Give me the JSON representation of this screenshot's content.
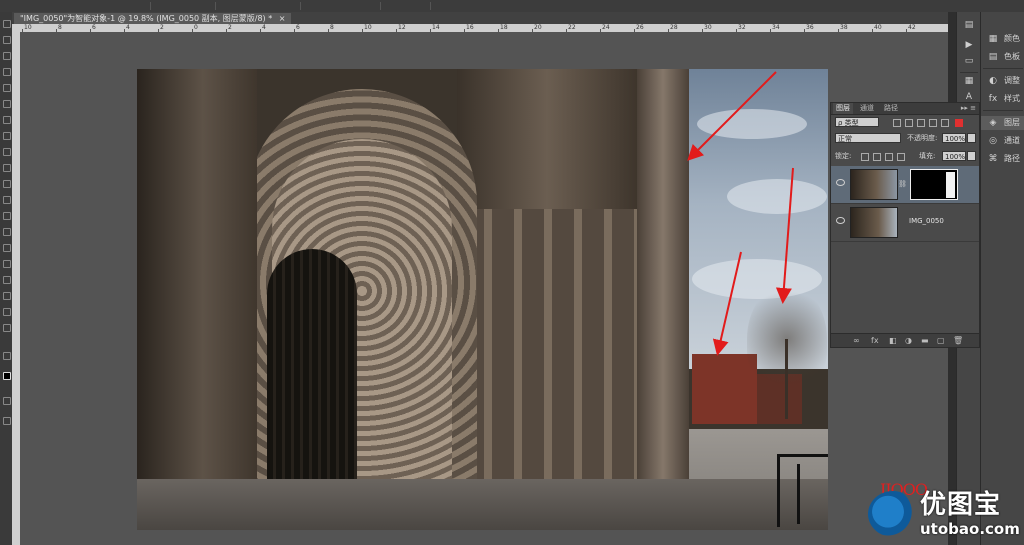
{
  "document": {
    "tab_title": "\"IMG_0050\"为智能对象-1 @ 19.8% (IMG_0050 副本, 图层蒙版/8) *",
    "close_icon": "×"
  },
  "ruler": {
    "labels": [
      "10",
      "8",
      "6",
      "4",
      "2",
      "0",
      "2",
      "4",
      "6",
      "8",
      "10",
      "12",
      "14",
      "16",
      "18",
      "20",
      "22",
      "24",
      "26",
      "28",
      "30",
      "32",
      "34",
      "36",
      "38",
      "40",
      "42"
    ]
  },
  "right_panels": {
    "items": [
      {
        "icon": "palette-icon",
        "glyph": "▦",
        "label": "颜色"
      },
      {
        "icon": "swatches-icon",
        "glyph": "▤",
        "label": "色板"
      },
      {
        "icon": "adjustments-icon",
        "glyph": "◐",
        "label": "调整"
      },
      {
        "icon": "styles-icon",
        "glyph": "fx",
        "label": "样式"
      },
      {
        "icon": "layers-icon",
        "glyph": "◈",
        "label": "图层"
      },
      {
        "icon": "channels-icon",
        "glyph": "◎",
        "label": "通道"
      },
      {
        "icon": "paths-icon",
        "glyph": "⌘",
        "label": "路径"
      }
    ]
  },
  "layers_panel": {
    "tabs": [
      "图层",
      "通道",
      "路径"
    ],
    "menu_glyph": "▸▸ ≡",
    "filter_label": "ρ 类型",
    "filter_icons": [
      "▣",
      "◐",
      "T",
      "▭",
      "▤",
      "●"
    ],
    "blend_mode": "正常",
    "opacity_label": "不透明度:",
    "opacity_value": "100%",
    "lock_label": "锁定:",
    "lock_icons": [
      "⊞",
      "✎",
      "✥",
      "🔒"
    ],
    "fill_label": "填充:",
    "fill_value": "100%",
    "layers": [
      {
        "name": "",
        "selected": true,
        "has_mask": true
      },
      {
        "name": "IMG_0050",
        "selected": false,
        "has_mask": false
      }
    ],
    "bottom_icons": [
      "∞",
      "fx",
      "◧",
      "◑",
      "▬",
      "▢",
      "🗑"
    ]
  },
  "watermark": {
    "title": "优图宝",
    "url": "utobao.com",
    "stamp": "IIOOO"
  },
  "colors": {
    "ui_dark": "#3c3c3c",
    "canvas_bg": "#545454",
    "panel_bg": "#4a4a4a",
    "selected_layer": "#5f6b78",
    "arrow_red": "#e21b1b"
  }
}
